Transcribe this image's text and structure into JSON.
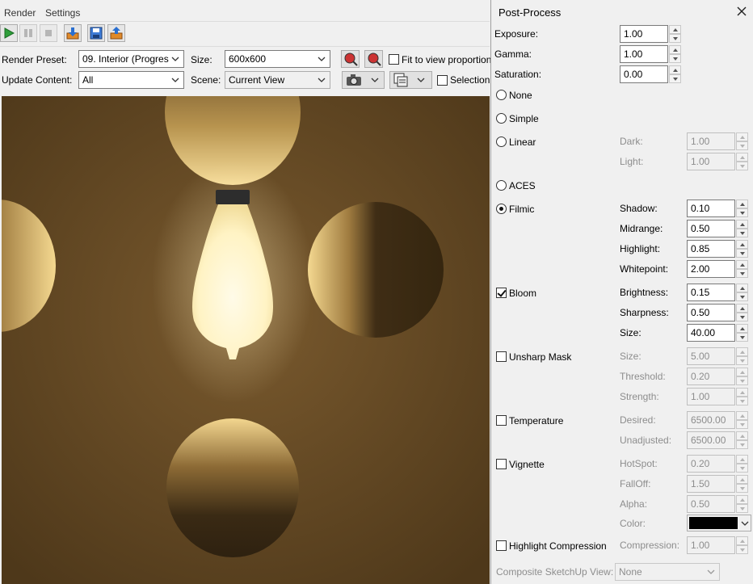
{
  "menu": {
    "render": "Render",
    "settings": "Settings"
  },
  "toolbar": {
    "icons": [
      "play-icon",
      "pause-icon",
      "stop-icon",
      "export-icon",
      "save-icon",
      "open-icon"
    ]
  },
  "render_preset": {
    "label": "Render Preset:",
    "value": "09. Interior (Progres"
  },
  "size": {
    "label": "Size:",
    "value": "600x600"
  },
  "fit_view": {
    "label": "Fit to view proportion",
    "checked": false
  },
  "update_content": {
    "label": "Update Content:",
    "value": "All"
  },
  "scene": {
    "label": "Scene:",
    "value": "Current View"
  },
  "selection": {
    "label": "Selection",
    "checked": false
  },
  "panel": {
    "title": "Post-Process",
    "exposure": {
      "label": "Exposure:",
      "value": "1.00"
    },
    "gamma": {
      "label": "Gamma:",
      "value": "1.00"
    },
    "saturation": {
      "label": "Saturation:",
      "value": "0.00"
    },
    "tonemap": {
      "none": "None",
      "simple": "Simple",
      "linear": "Linear",
      "aces": "ACES",
      "filmic": "Filmic",
      "selected": "Filmic"
    },
    "linear_params": {
      "dark_label": "Dark:",
      "dark": "1.00",
      "light_label": "Light:",
      "light": "1.00"
    },
    "filmic_params": {
      "shadow_label": "Shadow:",
      "shadow": "0.10",
      "midrange_label": "Midrange:",
      "midrange": "0.50",
      "highlight_label": "Highlight:",
      "highlight": "0.85",
      "whitepoint_label": "Whitepoint:",
      "whitepoint": "2.00"
    },
    "bloom": {
      "label": "Bloom",
      "checked": true,
      "brightness_label": "Brightness:",
      "brightness": "0.15",
      "sharpness_label": "Sharpness:",
      "sharpness": "0.50",
      "size_label": "Size:",
      "size": "40.00"
    },
    "unsharp": {
      "label": "Unsharp Mask",
      "checked": false,
      "size_label": "Size:",
      "size": "5.00",
      "threshold_label": "Threshold:",
      "threshold": "0.20",
      "strength_label": "Strength:",
      "strength": "1.00"
    },
    "temperature": {
      "label": "Temperature",
      "checked": false,
      "desired_label": "Desired:",
      "desired": "6500.00",
      "unadjusted_label": "Unadjusted:",
      "unadjusted": "6500.00"
    },
    "vignette": {
      "label": "Vignette",
      "checked": false,
      "hotspot_label": "HotSpot:",
      "hotspot": "0.20",
      "falloff_label": "FallOff:",
      "falloff": "1.50",
      "alpha_label": "Alpha:",
      "alpha": "0.50",
      "color_label": "Color:",
      "color": "#000000"
    },
    "highlight_comp": {
      "label": "Highlight Compression",
      "checked": false,
      "comp_label": "Compression:",
      "comp": "1.00"
    },
    "composite": {
      "label": "Composite SketchUp View:",
      "value": "None"
    }
  }
}
